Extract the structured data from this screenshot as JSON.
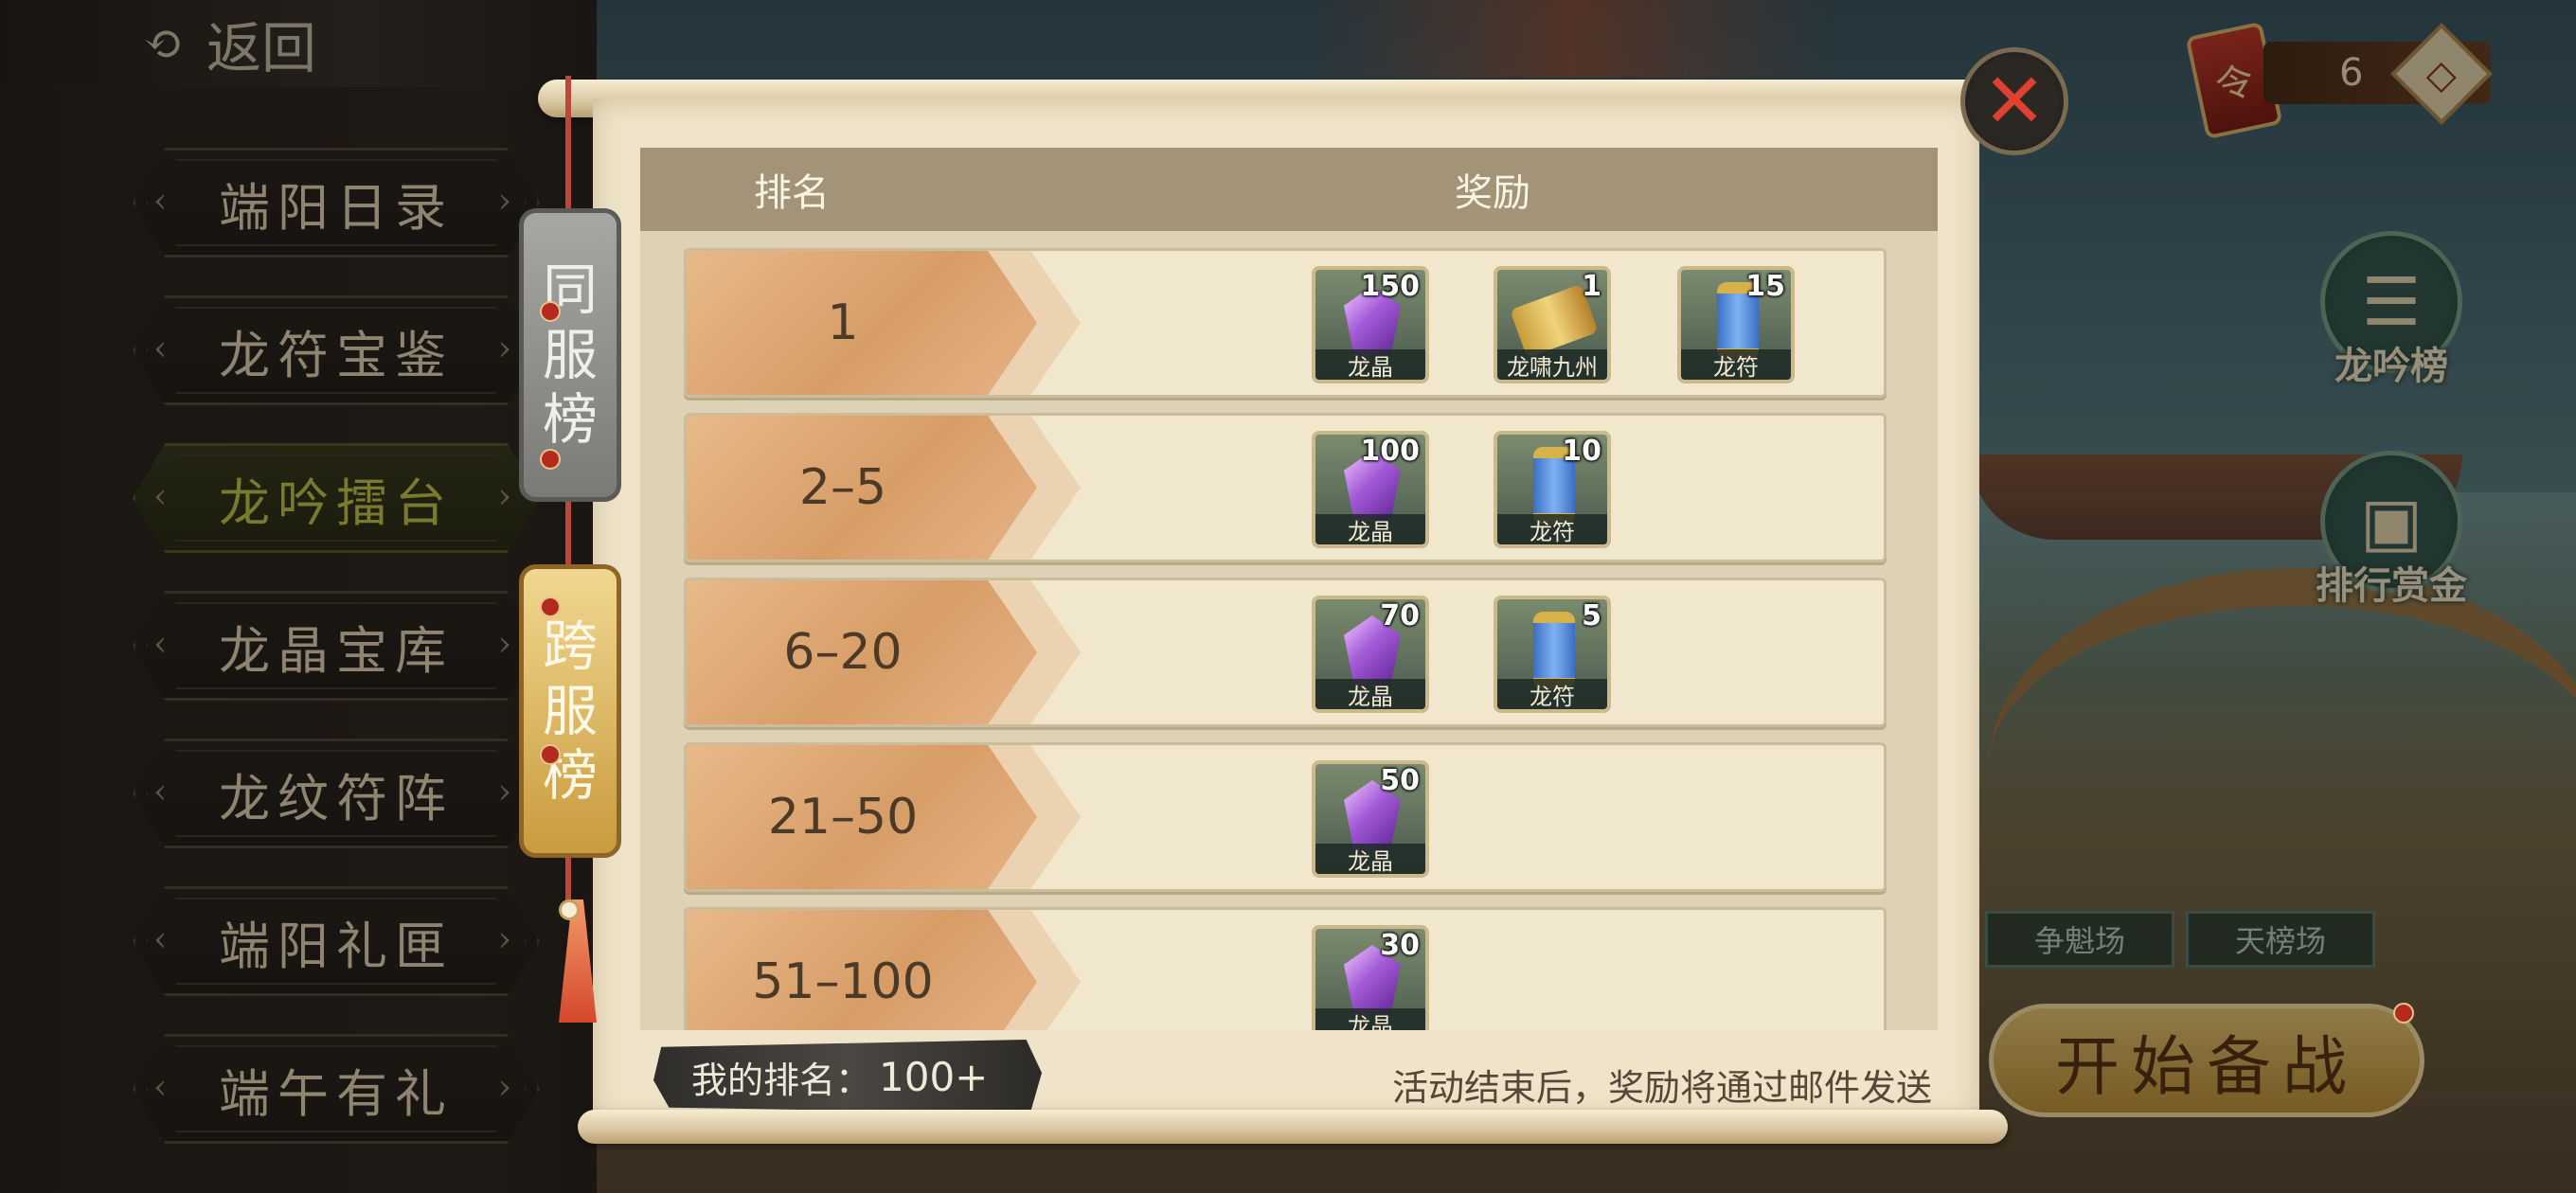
{
  "header": {
    "back_label": "返回"
  },
  "sidebar": {
    "items": [
      {
        "label": "端阳日录",
        "active": false,
        "badge": false
      },
      {
        "label": "龙符宝鉴",
        "active": false,
        "badge": true
      },
      {
        "label": "龙吟擂台",
        "active": true,
        "badge": true
      },
      {
        "label": "龙晶宝库",
        "active": false,
        "badge": true
      },
      {
        "label": "龙纹符阵",
        "active": false,
        "badge": true
      },
      {
        "label": "端阳礼匣",
        "active": false,
        "badge": false
      },
      {
        "label": "端午有礼",
        "active": false,
        "badge": false
      }
    ]
  },
  "hud": {
    "currency_count": "6",
    "add_symbol": "◇"
  },
  "right_panel": {
    "dragon_rank_label": "龙吟榜",
    "bounty_label": "排行赏金",
    "tabs": [
      "争魁场",
      "天榜场"
    ],
    "start_label": "开始备战"
  },
  "modal": {
    "tabs": {
      "same_server": "同服榜",
      "cross_server": "跨服榜",
      "selected": "cross_server"
    },
    "table": {
      "col_rank": "排名",
      "col_reward": "奖励",
      "rows": [
        {
          "rank": "1",
          "rewards": [
            {
              "name": "龙晶",
              "count": "150",
              "kind": "gem"
            },
            {
              "name": "龙啸九州",
              "count": "1",
              "kind": "book"
            },
            {
              "name": "龙符",
              "count": "15",
              "kind": "scroll"
            }
          ]
        },
        {
          "rank": "2–5",
          "rewards": [
            {
              "name": "龙晶",
              "count": "100",
              "kind": "gem"
            },
            {
              "name": "龙符",
              "count": "10",
              "kind": "scroll"
            }
          ]
        },
        {
          "rank": "6–20",
          "rewards": [
            {
              "name": "龙晶",
              "count": "70",
              "kind": "gem"
            },
            {
              "name": "龙符",
              "count": "5",
              "kind": "scroll"
            }
          ]
        },
        {
          "rank": "21–50",
          "rewards": [
            {
              "name": "龙晶",
              "count": "50",
              "kind": "gem"
            }
          ]
        },
        {
          "rank": "51–100",
          "rewards": [
            {
              "name": "龙晶",
              "count": "30",
              "kind": "gem"
            }
          ]
        }
      ]
    },
    "my_rank_label": "我的排名：",
    "my_rank_value": "100+",
    "notice": "活动结束后，奖励将通过邮件发送",
    "close_symbol": "✕"
  },
  "colors": {
    "paper": "#efe4c9",
    "header_band": "#a39479",
    "rank_plate": "#d79d67",
    "close_red": "#e0402f",
    "active_tab_gold": "#c99b3e"
  }
}
